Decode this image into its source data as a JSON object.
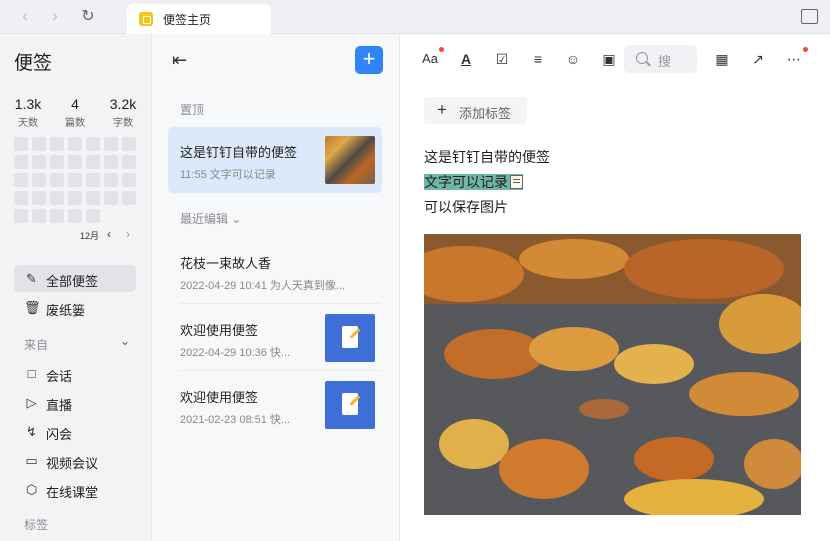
{
  "tab": {
    "title": "便签主页"
  },
  "sidebar": {
    "title": "便签",
    "stats": [
      {
        "value": "1.3k",
        "label": "天数"
      },
      {
        "value": "4",
        "label": "篇数"
      },
      {
        "value": "3.2k",
        "label": "字数"
      }
    ],
    "month": "12月",
    "items": [
      {
        "label": "全部便签",
        "icon": "note-edit-icon"
      },
      {
        "label": "废纸篓",
        "icon": "trash-icon"
      }
    ],
    "from_label": "来自",
    "sources": [
      {
        "label": "会话",
        "icon": "chat-icon"
      },
      {
        "label": "直播",
        "icon": "live-icon"
      },
      {
        "label": "闪会",
        "icon": "flash-meeting-icon"
      },
      {
        "label": "视频会议",
        "icon": "video-icon"
      },
      {
        "label": "在线课堂",
        "icon": "classroom-icon"
      }
    ],
    "tags_label": "标签"
  },
  "list": {
    "pinned_label": "置顶",
    "recent_label": "最近编辑",
    "pinned": {
      "title": "这是钉钉自带的便签",
      "meta": "11:55 文字可以记录"
    },
    "notes": [
      {
        "title": "花枝一束故人香",
        "meta": "2022-04-29 10:41 为人天真到像..."
      },
      {
        "title": "欢迎使用便签",
        "meta": "2022-04-29 10:36 快..."
      },
      {
        "title": "欢迎使用便签",
        "meta": "2021-02-23 08:51 快..."
      }
    ]
  },
  "editor": {
    "search_placeholder": "搜",
    "font_label": "Aa",
    "underline_label": "A",
    "add_tag_label": "添加标签",
    "lines": [
      "这是钉钉自带的便签",
      "文字可以记录",
      "可以保存图片"
    ]
  },
  "colors": {
    "accent": "#2f84f7",
    "highlight": "#6fb6a7",
    "badge": "#f5c518",
    "dot": "#f0483e"
  }
}
